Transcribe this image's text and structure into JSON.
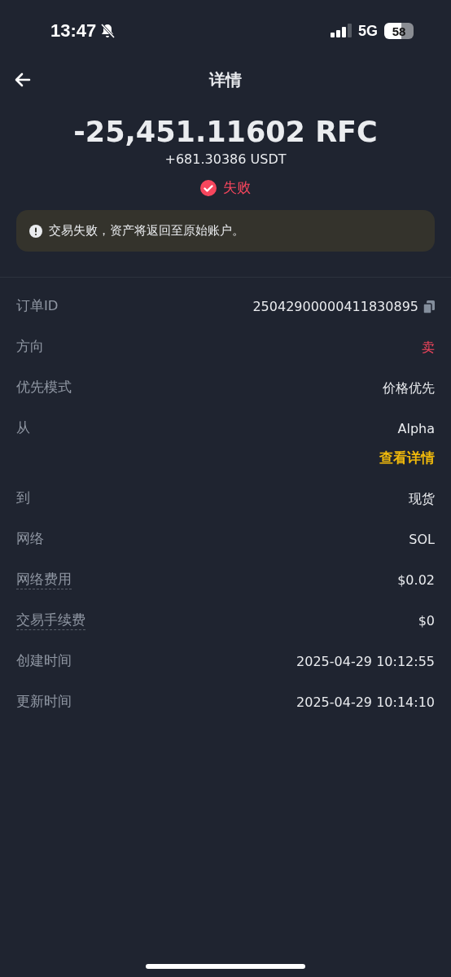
{
  "status_bar": {
    "time": "13:47",
    "network": "5G",
    "battery": "58"
  },
  "header": {
    "title": "详情"
  },
  "summary": {
    "amount": "-25,451.11602 RFC",
    "counter_amount": "+681.30386 USDT",
    "status": "失败",
    "notice": "交易失败，资产将返回至原始账户。"
  },
  "details": [
    {
      "label": "订单ID",
      "value": "25042900000411830895",
      "kind": "copy",
      "dotted": false
    },
    {
      "label": "方向",
      "value": "卖",
      "kind": "sell",
      "dotted": false
    },
    {
      "label": "优先模式",
      "value": "价格优先",
      "kind": "plain",
      "dotted": false
    },
    {
      "label": "从",
      "value": "Alpha",
      "kind": "plain",
      "dotted": false,
      "link": "查看详情"
    },
    {
      "label": "到",
      "value": "现货",
      "kind": "plain",
      "dotted": false
    },
    {
      "label": "网络",
      "value": "SOL",
      "kind": "plain",
      "dotted": false
    },
    {
      "label": "网络费用",
      "value": "$0.02",
      "kind": "plain",
      "dotted": true
    },
    {
      "label": "交易手续费",
      "value": "$0",
      "kind": "plain",
      "dotted": true
    },
    {
      "label": "创建时间",
      "value": "2025-04-29 10:12:55",
      "kind": "plain",
      "dotted": false
    },
    {
      "label": "更新时间",
      "value": "2025-04-29 10:14:10",
      "kind": "plain",
      "dotted": false
    }
  ]
}
